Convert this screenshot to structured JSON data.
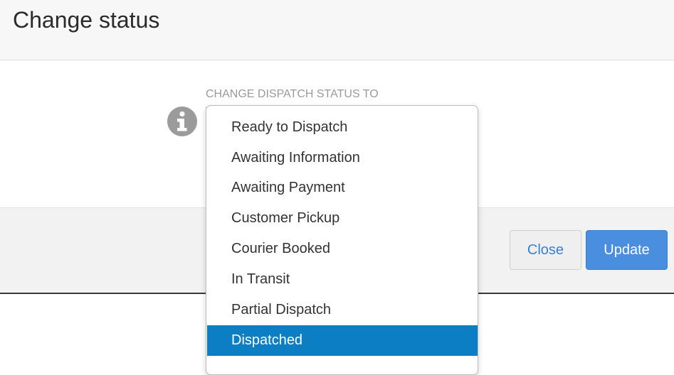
{
  "dialog": {
    "title": "Change status"
  },
  "field": {
    "label": "CHANGE DISPATCH STATUS TO",
    "icon": "info-circle-icon"
  },
  "dropdown": {
    "options": [
      "Ready to Dispatch",
      "Awaiting Information",
      "Awaiting Payment",
      "Customer Pickup",
      "Courier Booked",
      "In Transit",
      "Partial Dispatch",
      "Dispatched"
    ],
    "selected": "Dispatched",
    "highlight_color": "#0b7ec4"
  },
  "footer": {
    "close_label": "Close",
    "update_label": "Update"
  },
  "colors": {
    "primary": "#4a8fdf",
    "link": "#3a80d2"
  }
}
